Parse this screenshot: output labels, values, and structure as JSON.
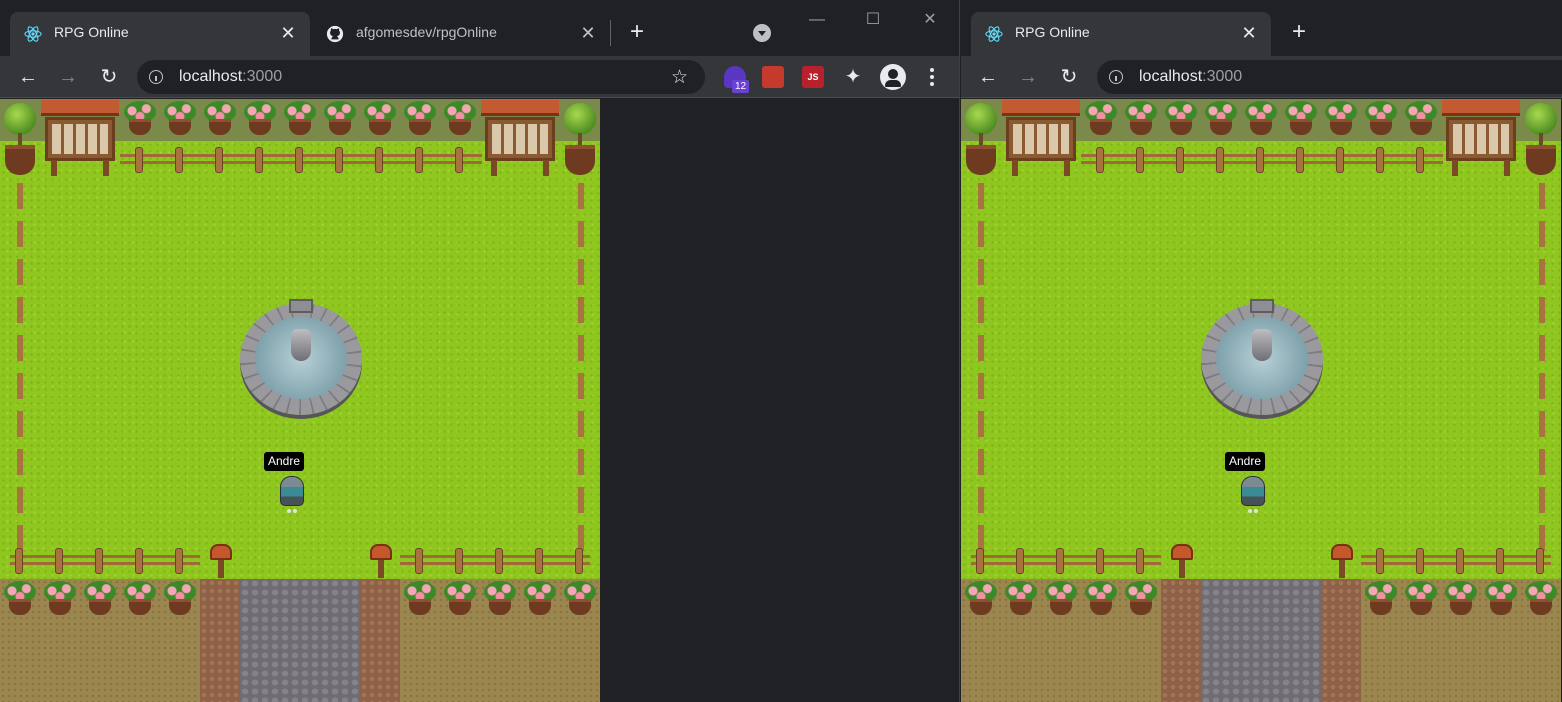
{
  "left_window": {
    "tabs": [
      {
        "title": "RPG Online",
        "close": "✕",
        "active": true
      },
      {
        "title": "afgomesdev/rpgOnline",
        "close": "✕",
        "active": false
      }
    ],
    "new_tab": "+",
    "controls": {
      "minimize": "—",
      "maximize": "☐",
      "close": "✕"
    },
    "nav": {
      "back": "←",
      "forward": "→",
      "reload": "↻"
    },
    "url": {
      "host": "localhost",
      "port": ":3000"
    },
    "bookmark": "☆",
    "extensions": {
      "badge": "12",
      "js_label": "JS",
      "puzzle": "✦"
    }
  },
  "right_window": {
    "tabs": [
      {
        "title": "RPG Online",
        "close": "✕",
        "active": true
      }
    ],
    "new_tab": "+",
    "nav": {
      "back": "←",
      "forward": "→",
      "reload": "↻"
    },
    "url": {
      "host": "localhost",
      "port": ":3000"
    }
  },
  "game": {
    "player_name": "Andre"
  },
  "colors": {
    "chrome_dark": "#202124",
    "chrome_toolbar": "#35363a",
    "grass": "#8fc61f",
    "nametag_bg": "#000000"
  },
  "icons": [
    "react-favicon",
    "github-favicon",
    "back-icon",
    "forward-icon",
    "reload-icon",
    "info-icon",
    "star-icon",
    "extension-icon",
    "profile-icon",
    "menu-icon",
    "tab-search-icon"
  ]
}
